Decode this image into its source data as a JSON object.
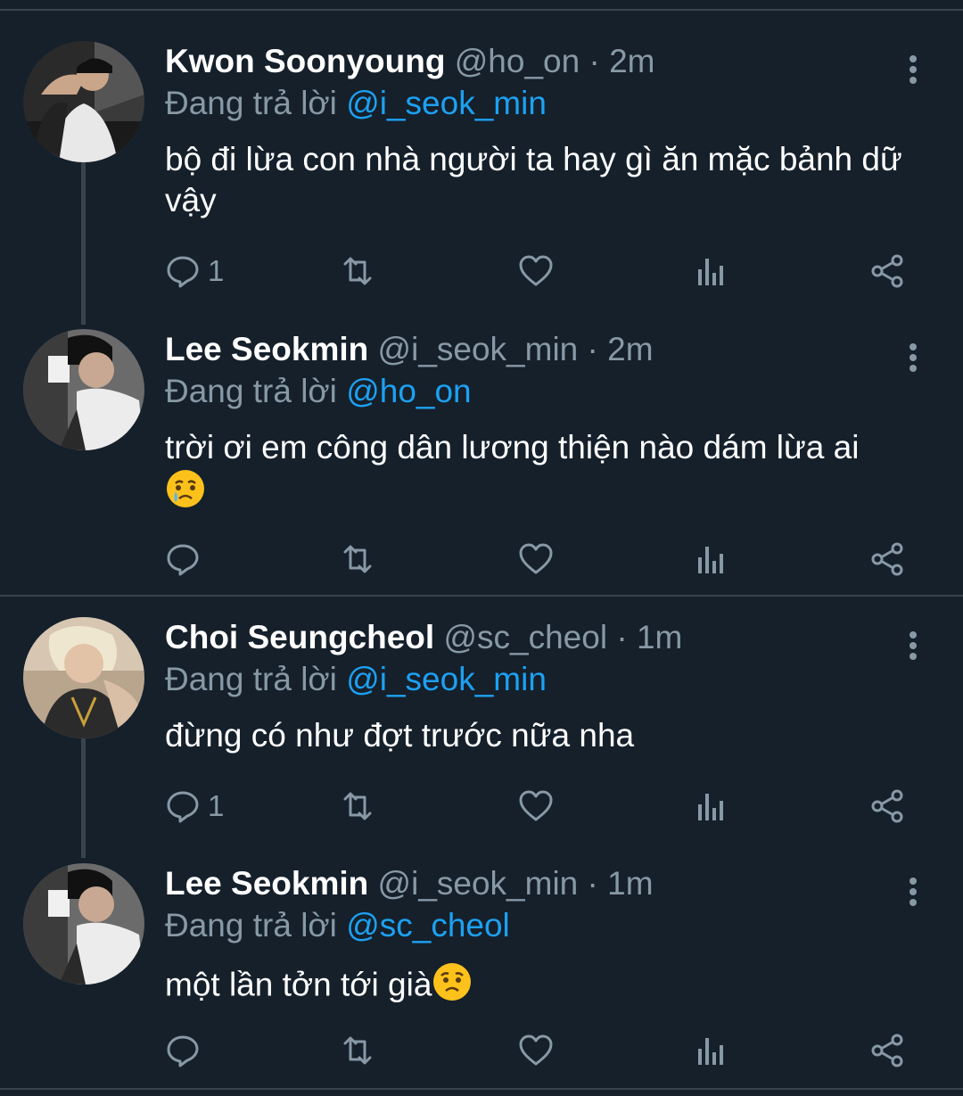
{
  "colors": {
    "background": "#15202b",
    "text": "#ffffff",
    "muted": "#8899a6",
    "accent": "#1da1f2",
    "divider": "#38444d"
  },
  "tweets": [
    {
      "name": "Kwon Soonyoung",
      "handle": "@ho_on",
      "dot": "·",
      "time": "2m",
      "replying_label": "Đang trả lời",
      "replying_to": "@i_seok_min",
      "text": "bộ đi lừa con nhà người ta hay gì ăn mặc bảnh dữ vậy",
      "reply_count": "1",
      "avatar_icon": "avatar-photo"
    },
    {
      "name": "Lee Seokmin",
      "handle": "@i_seok_min",
      "dot": "·",
      "time": "2m",
      "replying_label": "Đang trả lời",
      "replying_to": "@ho_on",
      "text": "trời ơi em công dân lương thiện nào dám lừa ai",
      "emoji": "crying-face-emoji",
      "reply_count": "",
      "avatar_icon": "avatar-photo"
    },
    {
      "name": "Choi Seungcheol",
      "handle": "@sc_cheol",
      "dot": "·",
      "time": "1m",
      "replying_label": "Đang trả lời",
      "replying_to": "@i_seok_min",
      "text": "đừng có như đợt trước nữa nha",
      "reply_count": "1",
      "avatar_icon": "avatar-photo"
    },
    {
      "name": "Lee Seokmin",
      "handle": "@i_seok_min",
      "dot": "·",
      "time": "1m",
      "replying_label": "Đang trả lời",
      "replying_to": "@sc_cheol",
      "text": "một lần tởn tới già",
      "emoji": "worried-face-emoji",
      "reply_count": "",
      "avatar_icon": "avatar-photo"
    }
  ]
}
